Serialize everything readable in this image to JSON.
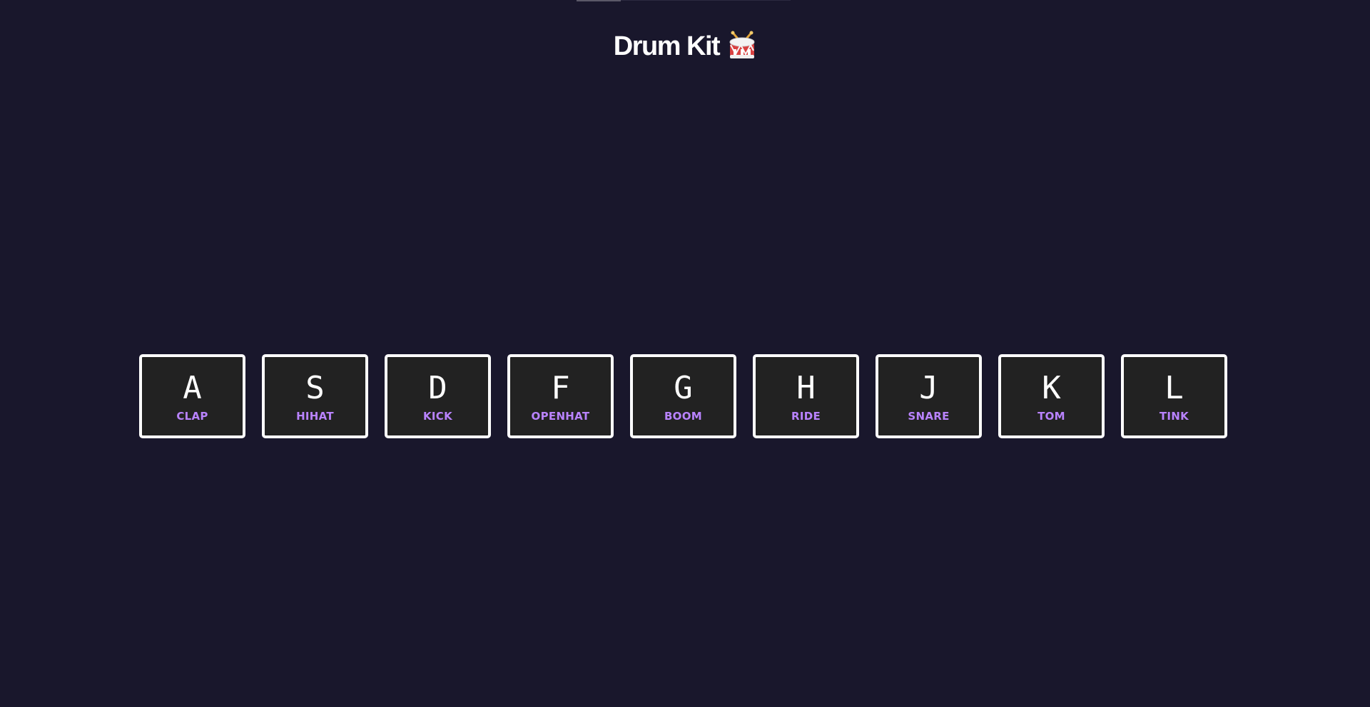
{
  "header": {
    "title": "Drum Kit",
    "icon": "drum-icon"
  },
  "colors": {
    "background": "#19172c",
    "key_background": "#222222",
    "key_border": "#ffffff",
    "sound_label": "#b983ff"
  },
  "keys": [
    {
      "letter": "A",
      "sound": "clap"
    },
    {
      "letter": "S",
      "sound": "hihat"
    },
    {
      "letter": "D",
      "sound": "kick"
    },
    {
      "letter": "F",
      "sound": "openhat"
    },
    {
      "letter": "G",
      "sound": "boom"
    },
    {
      "letter": "H",
      "sound": "ride"
    },
    {
      "letter": "J",
      "sound": "snare"
    },
    {
      "letter": "K",
      "sound": "tom"
    },
    {
      "letter": "L",
      "sound": "tink"
    }
  ]
}
